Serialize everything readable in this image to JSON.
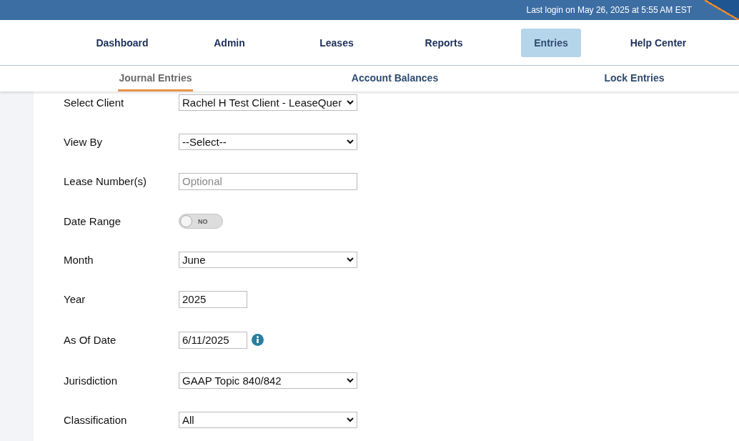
{
  "header": {
    "last_login": "Last login on May 26, 2025 at 5:55 AM EST"
  },
  "nav": [
    {
      "label": "Dashboard",
      "selected": false
    },
    {
      "label": "Admin",
      "selected": false
    },
    {
      "label": "Leases",
      "selected": false
    },
    {
      "label": "Reports",
      "selected": false
    },
    {
      "label": "Entries",
      "selected": true
    },
    {
      "label": "Help Center",
      "selected": false
    }
  ],
  "subnav": [
    {
      "label": "Journal Entries",
      "selected": true
    },
    {
      "label": "Account Balances",
      "selected": false
    },
    {
      "label": "Lock Entries",
      "selected": false
    }
  ],
  "form": [
    {
      "kind": "select",
      "label": "Select Client",
      "value": "Rachel H Test Client - LeaseQuer"
    },
    {
      "kind": "select",
      "label": "View By",
      "value": "--Select--"
    },
    {
      "kind": "text",
      "label": "Lease Number(s)",
      "placeholder": "Optional"
    },
    {
      "kind": "toggle",
      "label": "Date Range",
      "on": false,
      "text": "NO"
    },
    {
      "kind": "select",
      "label": "Month",
      "value": "June"
    },
    {
      "kind": "short-text",
      "label": "Year",
      "value": "2025"
    },
    {
      "kind": "date",
      "label": "As Of Date",
      "value": "6/11/2025"
    },
    {
      "kind": "select",
      "label": "Jurisdiction",
      "value": "GAAP Topic 840/842"
    },
    {
      "kind": "select",
      "label": "Classification",
      "value": "All"
    }
  ]
}
